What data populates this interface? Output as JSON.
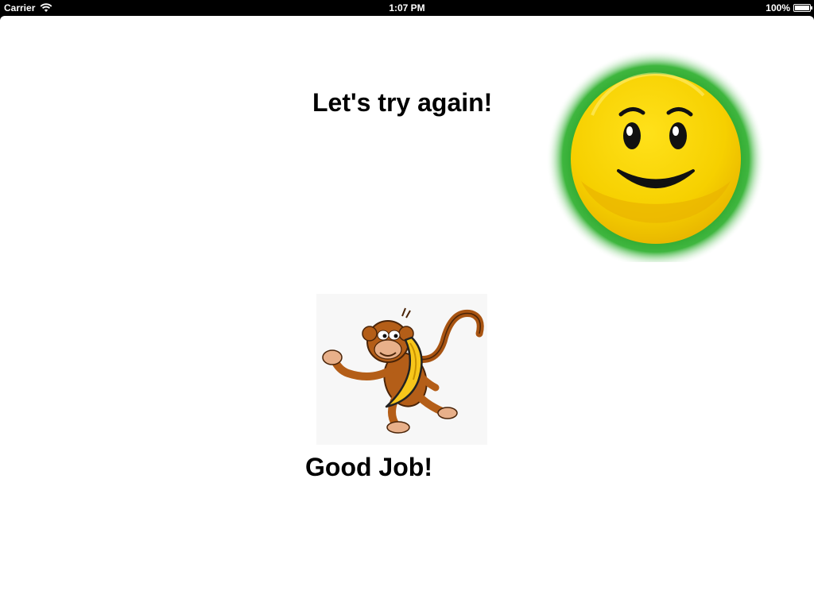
{
  "status_bar": {
    "carrier": "Carrier",
    "time": "1:07 PM",
    "battery": "100%",
    "battery_level": 1.0
  },
  "main": {
    "feedback_text": "Let's try again!",
    "praise_text": "Good Job!",
    "smiley_glow_color": "#2aa52a",
    "smiley_face_color": "#f6d000"
  },
  "icons": {
    "wifi": "wifi-icon",
    "battery": "battery-icon",
    "smiley": "smiley-face-icon",
    "monkey": "monkey-with-banana-image"
  }
}
